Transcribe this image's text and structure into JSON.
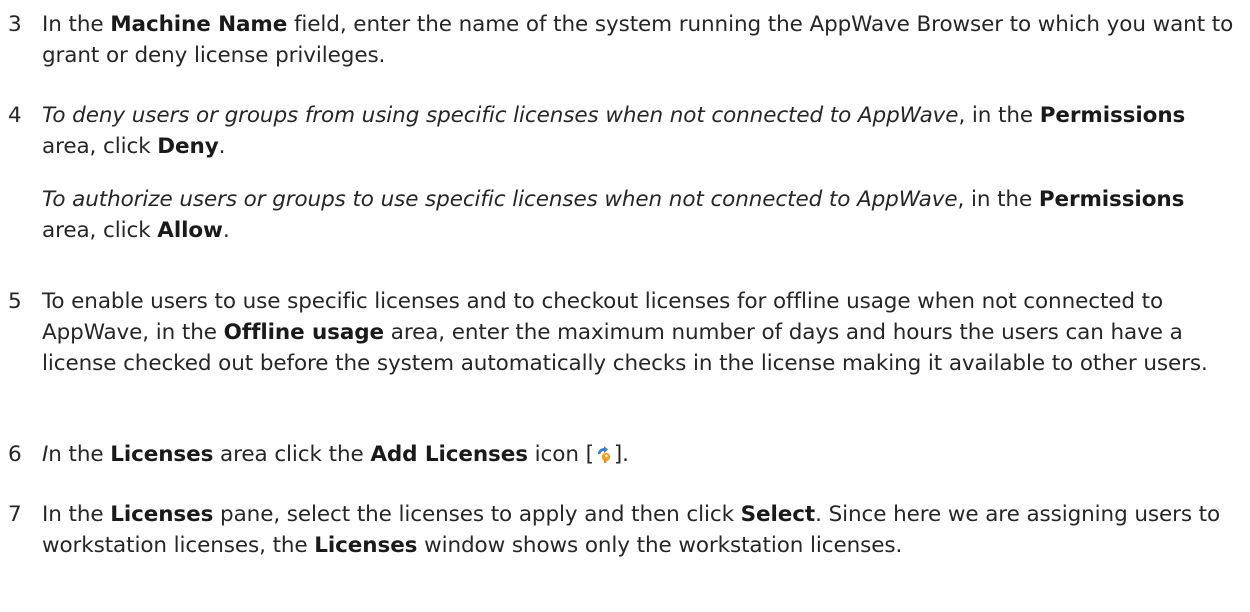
{
  "steps": [
    {
      "number": "3",
      "text_1": "In the ",
      "bold_1": "Machine Name",
      "text_2": " field, enter the name of the system running the AppWave Browser to which you want to grant or deny license privileges."
    },
    {
      "number": "4",
      "italic_1": "To deny users or groups from using specific licenses when not connected to AppWave",
      "text_1": ", in the ",
      "bold_1": "Permissions",
      "text_2": " area, click ",
      "bold_2": "Deny",
      "text_3": ".",
      "sub": {
        "italic_1": "To authorize users or groups to use specific licenses when not connected to AppWave",
        "text_1": ", in the ",
        "bold_1": "Permissions",
        "text_2": " area, click ",
        "bold_2": "Allow",
        "text_3": "."
      }
    },
    {
      "number": "5",
      "text_1": "To enable users to use specific licenses and to checkout licenses for offline usage when not connected to AppWave, in the ",
      "bold_1": "Offline usage",
      "text_2": " area, enter the maximum number of days and hours the users can have a license checked out before the system automatically checks in the license making it available to other users."
    },
    {
      "number": "6",
      "italic_1": "I",
      "text_1": "n the ",
      "bold_1": "Licenses",
      "text_2": " area click the ",
      "bold_2": "Add Licenses",
      "text_3": " icon [",
      "icon": "add-licenses-icon",
      "text_4": "]."
    },
    {
      "number": "7",
      "text_1": "In the ",
      "bold_1": "Licenses",
      "text_2": " pane, select the licenses to apply and then click ",
      "bold_2": "Select",
      "text_3": ". Since here we are assigning users to workstation licenses, the ",
      "bold_3": "Licenses",
      "text_4": " window shows only the workstation licenses."
    }
  ],
  "colors": {
    "text": "#262626",
    "icon_primary": "#f0a030",
    "icon_secondary": "#3a7fc8"
  }
}
